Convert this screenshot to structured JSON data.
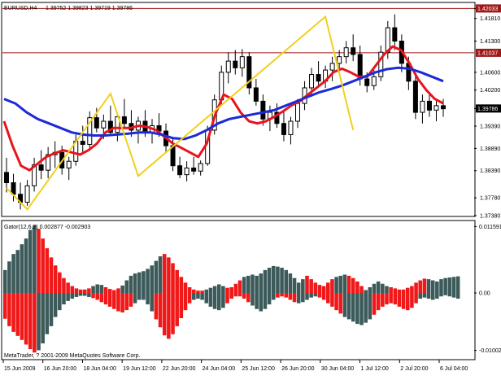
{
  "header": {
    "symbol": "EURUSD,H4",
    "quote": "1.39752 1.39823 1.39719 1.39786"
  },
  "indicator": {
    "title": "Gator(12,6,2) 0.002877 -0.002903"
  },
  "copyright": "MetaTrader, ? 2001-2009 MetaQuotes Software Corp.",
  "colors": {
    "candle": "#000000",
    "zigzag": "#f2cf1c",
    "red_ma": "#e8141c",
    "blue_ma": "#1c2ad8",
    "hline": "#a01818",
    "gator_up": "#3c5a5a",
    "gator_down": "#f01818",
    "grid_border": "#000000"
  },
  "chart_data": [
    {
      "type": "candlestick",
      "title": "EURUSD,H4",
      "y_ticks": [
        "1.42033",
        "1.41810",
        "1.41300",
        "1.40600",
        "1.40200",
        "1.39786",
        "1.39390",
        "1.38890",
        "1.38390",
        "1.37780",
        "1.37380"
      ],
      "badges": [
        {
          "label": "1.42033",
          "value": 1.42033
        },
        {
          "label": "1.41037",
          "value": 1.41037
        },
        {
          "label": "1.39786",
          "value": 1.39786
        }
      ],
      "hlines": [
        1.42033,
        1.41037
      ],
      "ylim": [
        1.3738,
        1.4215
      ],
      "x_labels": [
        "15 Jun 2009",
        "16 Jun 20:00",
        "18 Jun 04:00",
        "19 Jun 12:00",
        "22 Jun 20:00",
        "24 Jun 04:00",
        "25 Jun 12:00",
        "26 Jun 20:00",
        "30 Jun 04:00",
        "1 Jul 12:00",
        "2 Jul 20:00",
        "6 Jul 04:00"
      ],
      "candles_ohlc": [
        [
          1.3835,
          1.3868,
          1.379,
          1.3812
        ],
        [
          1.3812,
          1.3832,
          1.377,
          1.3786
        ],
        [
          1.3786,
          1.3812,
          1.3752,
          1.3768
        ],
        [
          1.3768,
          1.3818,
          1.376,
          1.3805
        ],
        [
          1.3805,
          1.3868,
          1.3792,
          1.3852
        ],
        [
          1.3852,
          1.3885,
          1.382,
          1.384
        ],
        [
          1.384,
          1.3892,
          1.3822,
          1.3875
        ],
        [
          1.3875,
          1.3905,
          1.3845,
          1.388
        ],
        [
          1.388,
          1.3895,
          1.383,
          1.3845
        ],
        [
          1.3845,
          1.387,
          1.3818,
          1.386
        ],
        [
          1.386,
          1.392,
          1.385,
          1.3905
        ],
        [
          1.3905,
          1.394,
          1.388,
          1.3898
        ],
        [
          1.3898,
          1.3972,
          1.389,
          1.3958
        ],
        [
          1.3958,
          1.398,
          1.3925,
          1.3935
        ],
        [
          1.3935,
          1.3965,
          1.391,
          1.395
        ],
        [
          1.395,
          1.3985,
          1.392,
          1.3925
        ],
        [
          1.3925,
          1.3968,
          1.3905,
          1.396
        ],
        [
          1.396,
          1.4,
          1.3935,
          1.3945
        ],
        [
          1.3945,
          1.3975,
          1.3915,
          1.393
        ],
        [
          1.393,
          1.396,
          1.39,
          1.395
        ],
        [
          1.395,
          1.3975,
          1.3915,
          1.3925
        ],
        [
          1.3925,
          1.3955,
          1.39,
          1.394
        ],
        [
          1.394,
          1.3968,
          1.3915,
          1.3928
        ],
        [
          1.3928,
          1.3945,
          1.388,
          1.3895
        ],
        [
          1.3895,
          1.3915,
          1.3838,
          1.385
        ],
        [
          1.385,
          1.387,
          1.3822,
          1.383
        ],
        [
          1.383,
          1.386,
          1.3815,
          1.3845
        ],
        [
          1.3845,
          1.387,
          1.383,
          1.3838
        ],
        [
          1.3838,
          1.3862,
          1.3828,
          1.3855
        ],
        [
          1.3855,
          1.394,
          1.385,
          1.393
        ],
        [
          1.393,
          1.401,
          1.392,
          1.3998
        ],
        [
          1.3998,
          1.4075,
          1.3985,
          1.406
        ],
        [
          1.406,
          1.4105,
          1.4035,
          1.4085
        ],
        [
          1.4085,
          1.411,
          1.4055,
          1.407
        ],
        [
          1.407,
          1.4112,
          1.405,
          1.4095
        ],
        [
          1.4095,
          1.4105,
          1.401,
          1.4025
        ],
        [
          1.4025,
          1.4045,
          1.3985,
          1.3995
        ],
        [
          1.3995,
          1.401,
          1.394,
          1.3955
        ],
        [
          1.3955,
          1.3985,
          1.3928,
          1.397
        ],
        [
          1.397,
          1.399,
          1.3935,
          1.3945
        ],
        [
          1.3945,
          1.3975,
          1.3905,
          1.392
        ],
        [
          1.392,
          1.396,
          1.3898,
          1.395
        ],
        [
          1.395,
          1.4,
          1.3935,
          1.399
        ],
        [
          1.399,
          1.404,
          1.3975,
          1.4025
        ],
        [
          1.4025,
          1.407,
          1.4005,
          1.4055
        ],
        [
          1.4055,
          1.4085,
          1.403,
          1.404
        ],
        [
          1.404,
          1.4075,
          1.4025,
          1.4065
        ],
        [
          1.4065,
          1.4095,
          1.404,
          1.408
        ],
        [
          1.408,
          1.411,
          1.406,
          1.4095
        ],
        [
          1.4095,
          1.413,
          1.408,
          1.4115
        ],
        [
          1.4115,
          1.4145,
          1.4085,
          1.41
        ],
        [
          1.41,
          1.412,
          1.403,
          1.4045
        ],
        [
          1.4045,
          1.406,
          1.4015,
          1.403
        ],
        [
          1.403,
          1.4065,
          1.402,
          1.405
        ],
        [
          1.405,
          1.412,
          1.404,
          1.4105
        ],
        [
          1.4105,
          1.4175,
          1.409,
          1.416
        ],
        [
          1.416,
          1.419,
          1.411,
          1.413
        ],
        [
          1.413,
          1.4145,
          1.406,
          1.408
        ],
        [
          1.408,
          1.4095,
          1.402,
          1.404
        ],
        [
          1.404,
          1.4055,
          1.3955,
          1.397
        ],
        [
          1.397,
          1.401,
          1.3945,
          1.3995
        ],
        [
          1.3995,
          1.4015,
          1.396,
          1.3975
        ],
        [
          1.3975,
          1.3995,
          1.395,
          1.3985
        ],
        [
          1.3985,
          1.4,
          1.396,
          1.3978
        ]
      ],
      "series": [
        {
          "name": "Zigzag",
          "values": [
            [
              0,
              1.38
            ],
            [
              3,
              1.3752
            ],
            [
              15,
              1.4012
            ],
            [
              19,
              1.3827
            ],
            [
              46,
              1.4185
            ],
            [
              50,
              1.393
            ]
          ]
        },
        {
          "name": "Alligator Lips",
          "values": [
            1.395,
            1.3895,
            1.385,
            1.384,
            1.3855,
            1.387,
            1.3878,
            1.3885,
            1.388,
            1.3875,
            1.3885,
            1.39,
            1.3925,
            1.3935,
            1.3935,
            1.3935,
            1.394,
            1.3937,
            1.393,
            1.3915,
            1.39,
            1.389,
            1.388,
            1.387,
            1.39,
            1.3965,
            1.401,
            1.4,
            1.397,
            1.395,
            1.3945,
            1.395,
            1.396,
            1.3972,
            1.3985,
            1.3995,
            1.401,
            1.4025,
            1.404,
            1.406,
            1.4068,
            1.406,
            1.405,
            1.405,
            1.4075,
            1.41,
            1.4118,
            1.411,
            1.408,
            1.4045,
            1.402,
            1.4,
            1.399
          ]
        },
        {
          "name": "Alligator Jaw",
          "values": [
            1.4,
            1.399,
            1.397,
            1.3955,
            1.3945,
            1.3935,
            1.3925,
            1.392,
            1.3918,
            1.3918,
            1.392,
            1.3922,
            1.3925,
            1.3925,
            1.392,
            1.3912,
            1.391,
            1.3918,
            1.393,
            1.3945,
            1.3955,
            1.396,
            1.3965,
            1.397,
            1.3975,
            1.3985,
            1.3995,
            1.4005,
            1.4015,
            1.4022,
            1.403,
            1.404,
            1.405,
            1.406,
            1.4067,
            1.407,
            1.4068,
            1.406,
            1.405,
            1.404
          ]
        }
      ]
    },
    {
      "type": "bar",
      "title": "Gator(12,6,2) 0.002877 -0.002903",
      "y_ticks": [
        "0.011591",
        "0.00",
        "-0.010025"
      ],
      "ylim": [
        -0.0115,
        0.0125
      ],
      "upper_values": [
        0.004,
        0.0055,
        0.0068,
        0.0075,
        0.0085,
        0.0095,
        0.011,
        0.0118,
        0.0112,
        0.0095,
        0.0078,
        0.0062,
        0.0048,
        0.0036,
        0.0026,
        0.0018,
        0.0012,
        0.0008,
        0.0006,
        0.0006,
        0.0008,
        0.0012,
        0.0015,
        0.0014,
        0.001,
        0.0007,
        0.0005,
        0.0008,
        0.0013,
        0.0022,
        0.003,
        0.0034,
        0.0036,
        0.0038,
        0.0042,
        0.0048,
        0.0056,
        0.0064,
        0.0068,
        0.0062,
        0.0052,
        0.004,
        0.0028,
        0.0018,
        0.001,
        0.0006,
        0.0004,
        0.0004,
        0.0006,
        0.0009,
        0.0012,
        0.0015,
        0.0012,
        0.0009,
        0.001,
        0.0016,
        0.0022,
        0.0028,
        0.003,
        0.0032,
        0.003,
        0.0034,
        0.004,
        0.0044,
        0.0047,
        0.0046,
        0.0044,
        0.004,
        0.0034,
        0.0026,
        0.0018,
        0.0024,
        0.003,
        0.0024,
        0.0018,
        0.0014,
        0.0012,
        0.0018,
        0.0024,
        0.0028,
        0.003,
        0.0032,
        0.003,
        0.0026,
        0.002,
        0.0012,
        0.0005,
        0.001,
        0.0016,
        0.002,
        0.0016,
        0.0012,
        0.001,
        0.0008,
        0.0006,
        0.0006,
        0.0009,
        0.0012,
        0.0018,
        0.0022,
        0.0025,
        0.0024,
        0.0022,
        0.002,
        0.0024,
        0.0026,
        0.0027,
        0.0028,
        0.0029
      ],
      "upper_colors": "GGGGGGGGRRRRRRRRRRRRRGGGRRRRGGGGGGGGGGRRRRRRRRRRGGGGGRRRRGGGGGGGGGGGGGGGRRRRRRRGGGRRRRGGGGGGRRRRRRRRRGGGGGGGGGRRRRRGGGGG",
      "lower_values": [
        0.0045,
        0.0058,
        0.0068,
        0.0075,
        0.0082,
        0.009,
        0.0098,
        0.0104,
        0.01,
        0.0088,
        0.0072,
        0.0058,
        0.0042,
        0.003,
        0.002,
        0.0014,
        0.001,
        0.0007,
        0.0005,
        0.0005,
        0.0007,
        0.0009,
        0.0012,
        0.0016,
        0.002,
        0.0024,
        0.0028,
        0.0032,
        0.0034,
        0.003,
        0.0024,
        0.0018,
        0.0012,
        0.0012,
        0.002,
        0.0032,
        0.0046,
        0.006,
        0.0074,
        0.008,
        0.0072,
        0.0058,
        0.0044,
        0.003,
        0.0018,
        0.0012,
        0.001,
        0.0012,
        0.0018,
        0.0024,
        0.0028,
        0.003,
        0.0026,
        0.0018,
        0.001,
        0.0006,
        0.0006,
        0.001,
        0.0016,
        0.0022,
        0.0028,
        0.0032,
        0.0028,
        0.002,
        0.0012,
        0.0008,
        0.0006,
        0.0008,
        0.0012,
        0.0016,
        0.0018,
        0.0016,
        0.0012,
        0.0008,
        0.0006,
        0.0008,
        0.0012,
        0.0018,
        0.0024,
        0.003,
        0.0036,
        0.0042,
        0.0046,
        0.005,
        0.0054,
        0.0056,
        0.0052,
        0.0046,
        0.0038,
        0.003,
        0.0024,
        0.002,
        0.0018,
        0.002,
        0.0024,
        0.0028,
        0.003,
        0.0026,
        0.0018,
        0.001,
        0.0008,
        0.001,
        0.0012,
        0.001,
        0.0006,
        0.0004,
        0.0006,
        0.0008,
        0.001
      ],
      "lower_colors": "RRRRRRRRGGGGGGGGGGGGGRRRRRRRRRRGGGGGRRRRRRRRRGGGGGGGGRRRRRRGGGGGGRRRRRGGGGGRRRRRRGGGGGGGRRRRRRRRRRRGGGGGGGGGGRRGGGGGRRRRR"
    }
  ]
}
